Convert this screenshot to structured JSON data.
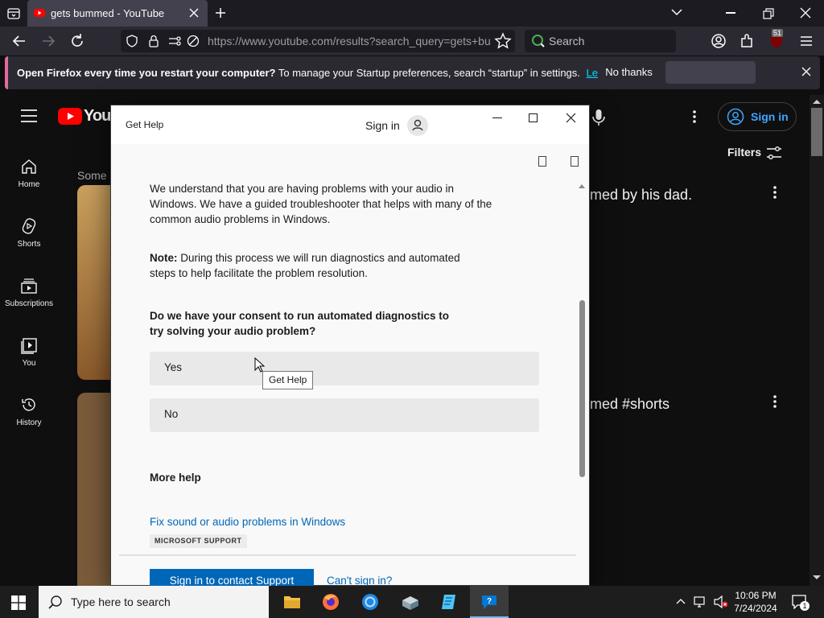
{
  "browser": {
    "tab_title": "gets bummed - YouTube",
    "url": "https://www.youtube.com/results?search_query=gets+bu",
    "search_placeholder": "Search",
    "extension_badge": "51"
  },
  "infobar": {
    "bold": "Open Firefox every time you restart your computer?",
    "text": "To manage your Startup preferences, search “startup” in settings.",
    "link": "Learn more",
    "no_thanks": "No thanks"
  },
  "youtube": {
    "logo_text": "YouTu",
    "sign_in": "Sign in",
    "filters": "Filters",
    "partial_heading": "Some",
    "nav": [
      {
        "label": "Home",
        "icon": "home-icon"
      },
      {
        "label": "Shorts",
        "icon": "shorts-icon"
      },
      {
        "label": "Subscriptions",
        "icon": "subscriptions-icon"
      },
      {
        "label": "You",
        "icon": "you-icon"
      },
      {
        "label": "History",
        "icon": "history-icon"
      }
    ],
    "results": [
      {
        "title_fragment": "med by his dad."
      },
      {
        "title_fragment": "med #shorts"
      }
    ]
  },
  "gethelp": {
    "window_title": "Get Help",
    "sign_in": "Sign in",
    "intro": "We understand that you are having problems with your audio in Windows. We have a guided troubleshooter that helps with many of the common audio problems in Windows.",
    "note_label": "Note:",
    "note_text": " During this process we will run diagnostics and automated steps to help facilitate the problem resolution.",
    "question": "Do we have your consent to run automated diagnostics to try solving your audio problem?",
    "yes": "Yes",
    "no": "No",
    "tooltip": "Get Help",
    "more_help": "More help",
    "link_title": "Fix sound or audio problems in Windows",
    "link_source": "MICROSOFT SUPPORT",
    "contact_button": "Sign in to contact Support",
    "cant_sign_in": "Can't sign in?"
  },
  "taskbar": {
    "search_placeholder": "Type here to search",
    "time": "10:06 PM",
    "date": "7/24/2024",
    "notification_count": "1"
  },
  "colors": {
    "youtube_red": "#ff0000",
    "link_blue": "#0067b8",
    "primary_button": "#0067b8",
    "infobar_accent": "#e16a9e"
  }
}
